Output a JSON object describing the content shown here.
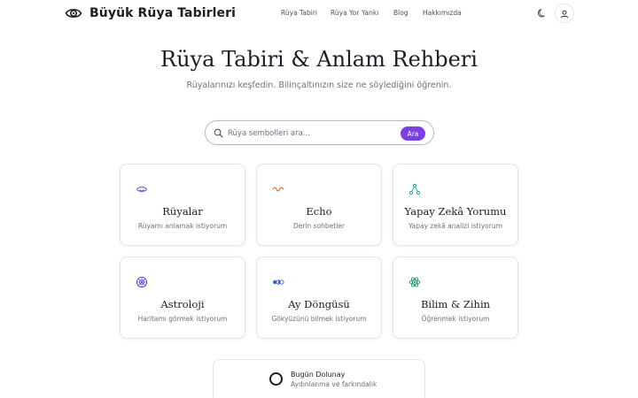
{
  "header": {
    "brand_title": "Büyük Rüya Tabirleri",
    "nav": [
      "Rüya Tabiri",
      "Rüya Yor",
      "Yankı",
      "Blog",
      "Hakkımızda"
    ]
  },
  "hero": {
    "title": "Rüya Tabiri & Anlam Rehberi",
    "subtitle": "Rüyalarınızı keşfedin. Bilinçaltınızın size ne söylediğini öğrenin."
  },
  "search": {
    "placeholder": "Rüya sembolleri ara...",
    "button_label": "Ara"
  },
  "cards": [
    {
      "title": "Rüyalar",
      "subtitle": "Rüyamı anlamak istiyorum",
      "icon": "eye-icon",
      "color": "#7b3fe4"
    },
    {
      "title": "Echo",
      "subtitle": "Derin sohbetler",
      "icon": "wave-icon",
      "color": "#e8742a"
    },
    {
      "title": "Yapay Zekâ Yorumu",
      "subtitle": "Yapay zekâ analizi istiyorum",
      "icon": "network-icon",
      "color": "#1aa5a0"
    },
    {
      "title": "Astroloji",
      "subtitle": "Haritamı görmek istiyorum",
      "icon": "zodiac-icon",
      "color": "#5a4fcf"
    },
    {
      "title": "Ay Döngüsü",
      "subtitle": "Gökyüzünü bilmek istiyorum",
      "icon": "moon-phases-icon",
      "color": "#3f63c9"
    },
    {
      "title": "Bilim & Zihin",
      "subtitle": "Öğrenmek istiyorum",
      "icon": "atom-icon",
      "color": "#1f9e5e"
    }
  ],
  "moon_status": {
    "title": "Bugün Dolunay",
    "subtitle": "Aydınlanma ve farkındalık"
  },
  "colors": {
    "accent": "#7b3fe4",
    "text": "#1b1e27",
    "muted": "#6b7080",
    "border": "#e2e4e9"
  }
}
